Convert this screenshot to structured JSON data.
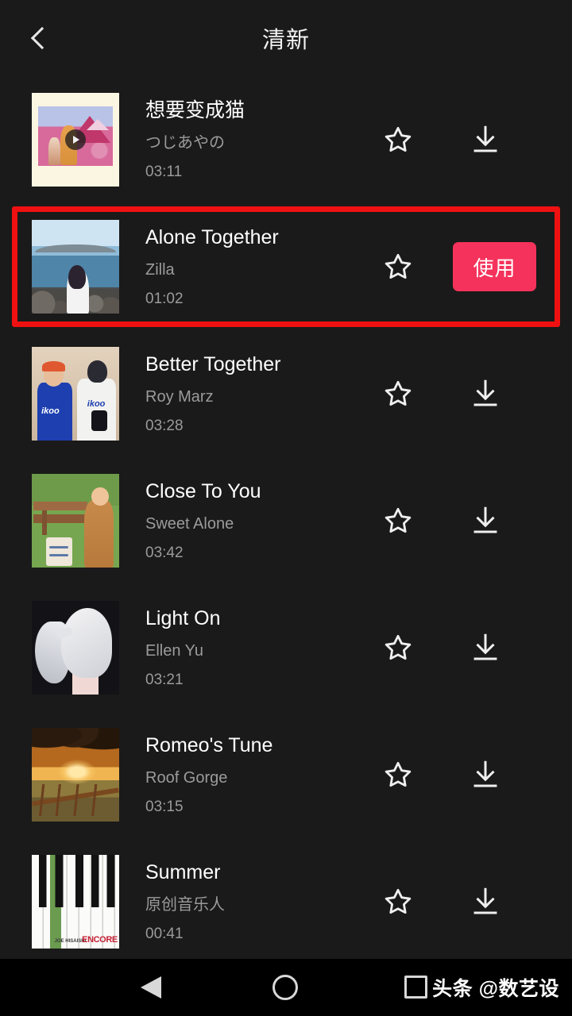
{
  "header": {
    "title": "清新",
    "back_icon": "chevron-left-icon"
  },
  "songs": [
    {
      "title": "想要变成猫",
      "artist": "つじあやの",
      "duration": "03:11",
      "action": "download",
      "art": "art-fuji",
      "playing": true,
      "selected": false
    },
    {
      "title": "Alone Together",
      "artist": "Zilla",
      "duration": "01:02",
      "action": "use",
      "action_label": "使用",
      "art": "art-sea",
      "playing": false,
      "selected": true
    },
    {
      "title": "Better Together",
      "artist": "Roy Marz",
      "duration": "03:28",
      "action": "download",
      "art": "art-ikoo",
      "playing": false,
      "selected": false
    },
    {
      "title": "Close To You",
      "artist": "Sweet Alone",
      "duration": "03:42",
      "action": "download",
      "art": "art-park",
      "playing": false,
      "selected": false
    },
    {
      "title": "Light On",
      "artist": "Ellen Yu",
      "duration": "03:21",
      "action": "download",
      "art": "art-anime",
      "playing": false,
      "selected": false
    },
    {
      "title": "Romeo's Tune",
      "artist": "Roof Gorge",
      "duration": "03:15",
      "action": "download",
      "art": "art-sunset",
      "playing": false,
      "selected": false
    },
    {
      "title": "Summer",
      "artist": "原创音乐人",
      "duration": "00:41",
      "action": "download",
      "art": "art-piano",
      "playing": false,
      "selected": false
    }
  ],
  "icons": {
    "favorite": "star-outline-icon",
    "download": "download-arrow-icon",
    "play": "play-circle-icon"
  },
  "navbar": {
    "back": "triangle-back-icon",
    "home": "circle-home-icon",
    "recents": "square-recents-icon",
    "watermark": "头条 @数艺设"
  },
  "thumbnail_labels": {
    "ikoo_left": "ikoo",
    "ikoo_right": "ikoo",
    "piano_encore": "ENCORE",
    "piano_small": "JOE HISAISHI"
  },
  "colors": {
    "background": "#1a1a1a",
    "navbar": "#000000",
    "accent_pink": "#f5325b",
    "highlight_red": "#ef1111",
    "title_text": "#ffffff",
    "secondary_text": "#9b9b9b",
    "icon": "#e8e8e8"
  }
}
